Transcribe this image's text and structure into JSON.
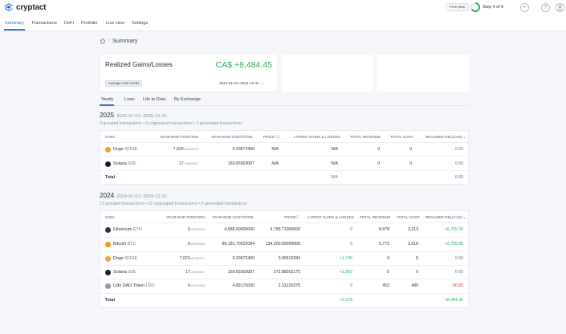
{
  "app": {
    "logo_text": "cryptact"
  },
  "header": {
    "free_plan": "Free plan",
    "step": "Step 4 of 6",
    "step_progress": 0.667,
    "icons": [
      "plus-circle-icon",
      "help-icon",
      "user-icon"
    ]
  },
  "nav": {
    "items": [
      {
        "label": "Summary",
        "active": true
      },
      {
        "label": "Transactions"
      },
      {
        "label": "DeFi"
      },
      {
        "label": "Portfolio"
      },
      {
        "label": "Live view"
      },
      {
        "label": "Settings"
      }
    ]
  },
  "breadcrumb": {
    "current": "Summary"
  },
  "gains_card": {
    "title": "Realized Gains/Losses",
    "value": "CA$ +8,484.45",
    "method": "Average Cost (ACB)",
    "date_range": "2024-01-01~2024-12-31"
  },
  "tabs": [
    "Yearly",
    "Loan",
    "Life to Date",
    "By Exchange"
  ],
  "columns": {
    "coin": "COIN",
    "year_end_position": "YEAR-END POSITION",
    "year_end_cost": "YEAR-END COST/COIN",
    "price": "PRICE",
    "latent": "LATENT GAINS & LOSSES",
    "revenue": "TOTAL REVENUE",
    "cost": "TOTAL COST",
    "realized": "REALIZED P&L(CAD)"
  },
  "years": [
    {
      "year": "2025",
      "range": "2025-01-01~2025-12-31",
      "counts": "0 grouped transactions  •  0 ungrouped transactions  •  0 generated transactions",
      "rows": [
        {
          "icon_color": "#f0a330",
          "name": "Doge",
          "sym": "DOGE",
          "pos_main": "7,023.",
          "pos_small": "80789747",
          "cost": "0.20672400",
          "price": "N/A",
          "latent": "N/A",
          "revenue": "0",
          "tcost": "0",
          "realized": "0.00",
          "realized_class": "muted"
        },
        {
          "icon_color": "#1b1f2a",
          "name": "Solana",
          "sym": "SOL",
          "pos_main": "17.",
          "pos_small": "74559812",
          "cost": "169.65503087",
          "price": "N/A",
          "latent": "N/A",
          "revenue": "0",
          "tcost": "0",
          "realized": "0.00",
          "realized_class": "muted"
        }
      ],
      "total": {
        "label": "Total",
        "latent": "N/A",
        "realized": "0.00",
        "latent_class": "muted",
        "realized_class": "muted"
      }
    },
    {
      "year": "2024",
      "range": "2024-01-01~2024-12-31",
      "counts": "12 grouped transactions  •  12 ungrouped transactions  •  0 generated transactions",
      "rows": [
        {
          "icon_color": "#2b3340",
          "name": "Ethereum",
          "sym": "ETH",
          "pos_main": "0.",
          "pos_small": "00000000",
          "cost": "4,588.90000000",
          "price": "4,785.71000000",
          "latent": "0",
          "revenue": "8,978",
          "tcost": "3,213",
          "realized": "+5,765.39",
          "realized_class": "pos",
          "latent_class": "muted"
        },
        {
          "icon_color": "#f39c12",
          "name": "Bitcoin",
          "sym": "BTC",
          "pos_main": "0.",
          "pos_small": "00000000",
          "cost": "86,181.70022084",
          "price": "134,200.00000000",
          "latent": "0",
          "revenue": "5,772",
          "tcost": "3,016",
          "realized": "+2,755.89",
          "realized_class": "pos",
          "latent_class": "muted"
        },
        {
          "icon_color": "#f0a330",
          "name": "Doge",
          "sym": "DOGE",
          "pos_main": "7,023.",
          "pos_small": "80789747",
          "cost": "0.20672400",
          "price": "0.45510284",
          "latent": "+1,745",
          "revenue": "0",
          "tcost": "0",
          "realized": "0.00",
          "realized_class": "muted",
          "latent_class": "pos"
        },
        {
          "icon_color": "#1b1f2a",
          "name": "Solana",
          "sym": "SOL",
          "pos_main": "17.",
          "pos_small": "74559812",
          "cost": "169.65503087",
          "price": "272.88302175",
          "latent": "+1,832",
          "revenue": "0",
          "tcost": "0",
          "realized": "0.00",
          "realized_class": "muted",
          "latent_class": "pos"
        },
        {
          "icon_color": "#8e9bb0",
          "name": "Lido DAO Token",
          "sym": "LDO",
          "pos_main": "0.",
          "pos_small": "00000000",
          "cost": "4.89170000",
          "price": "2.31220375",
          "latent": "0",
          "revenue": "453",
          "tcost": "489",
          "realized": "-36.83",
          "realized_class": "neg",
          "latent_class": "muted"
        }
      ],
      "total": {
        "label": "Total",
        "latent": "+3,576",
        "realized": "+8,484.45",
        "latent_class": "pos",
        "realized_class": "pos"
      }
    }
  ]
}
